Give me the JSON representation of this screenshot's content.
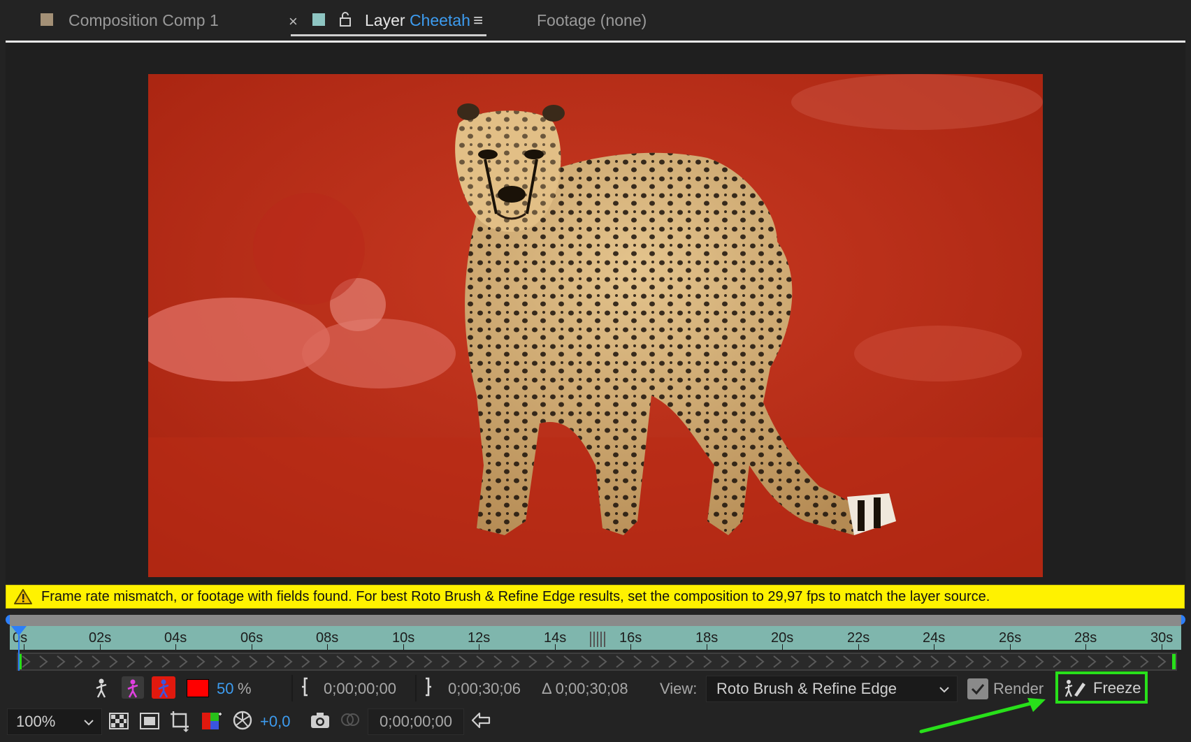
{
  "tabs": {
    "composition": "Composition Comp 1",
    "close": "×",
    "layer_prefix": "Layer",
    "layer_name": "Cheetah",
    "menu": "≡",
    "footage": "Footage (none)"
  },
  "warning": {
    "text": "Frame rate mismatch, or footage with fields found. For best Roto Brush & Refine Edge results, set the composition to 29,97 fps to match the layer source."
  },
  "ruler": {
    "ticks": [
      "0s",
      "02s",
      "04s",
      "06s",
      "08s",
      "10s",
      "12s",
      "14s",
      "16s",
      "18s",
      "20s",
      "22s",
      "24s",
      "26s",
      "28s",
      "30s"
    ]
  },
  "controls": {
    "opacity_value": "50",
    "opacity_unit": "%",
    "in_time": "0;00;00;00",
    "out_time": "0;00;30;06",
    "duration": "Δ 0;00;30;08",
    "view_label": "View:",
    "view_value": "Roto Brush & Refine Edge",
    "render_label": "Render",
    "freeze_label": "Freeze"
  },
  "status": {
    "zoom": "100%",
    "exposure": "+0,0",
    "current_time": "0;00;00;00"
  },
  "colors": {
    "accent_blue": "#3d9cf0",
    "overlay_red": "#e0190e",
    "warning_yellow": "#fff200",
    "highlight_green": "#28e01a"
  }
}
